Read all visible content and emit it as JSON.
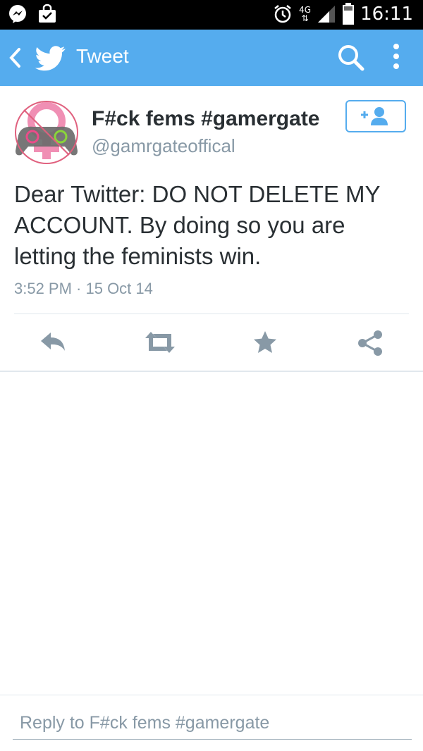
{
  "status_bar": {
    "time": "16:11",
    "network": "4G"
  },
  "app_bar": {
    "title": "Tweet",
    "color": "#55acee"
  },
  "tweet": {
    "display_name": "F#ck fems #gamergate",
    "handle": "@gamrgateoffical",
    "text": "Dear Twitter: DO NOT DELETE MY ACCOUNT. By doing so you are letting the feminists win.",
    "timestamp": "3:52 PM · 15 Oct 14"
  },
  "actions": [
    "reply-icon",
    "retweet-icon",
    "favorite-star-icon",
    "share-icon"
  ],
  "reply": {
    "placeholder": "Reply to F#ck fems #gamergate"
  },
  "colors": {
    "accent": "#55acee",
    "text": "#292f33",
    "secondary": "#8899a6",
    "icon": "#8899a6"
  }
}
